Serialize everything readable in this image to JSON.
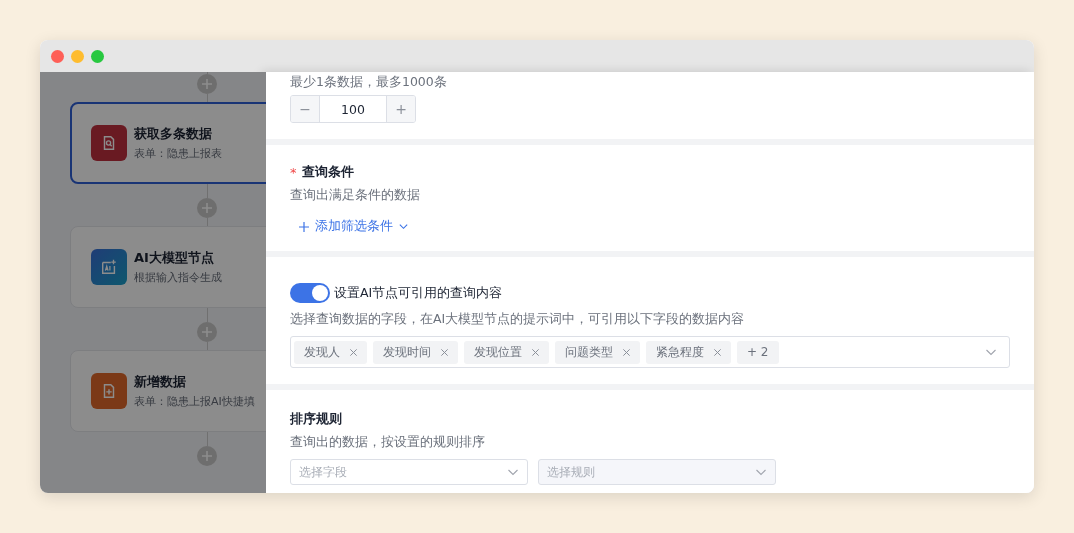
{
  "flow": {
    "nodes": [
      {
        "title": "获取多条数据",
        "subtitle": "表单：隐患上报表",
        "kind": "query",
        "selected": true
      },
      {
        "title": "AI大模型节点",
        "subtitle": "根据输入指令生成",
        "kind": "ai",
        "selected": false
      },
      {
        "title": "新增数据",
        "subtitle": "表单：隐患上报AI快捷填",
        "kind": "add",
        "selected": false
      }
    ]
  },
  "panel": {
    "limit": {
      "hint": "最少1条数据，最多1000条",
      "value": "100",
      "minus": "−",
      "plus": "+"
    },
    "conditions": {
      "required_mark": "*",
      "title": "查询条件",
      "hint": "查询出满足条件的数据",
      "add_link": "添加筛选条件"
    },
    "ai_fields": {
      "toggle_label": "设置AI节点可引用的查询内容",
      "on": true,
      "hint": "选择查询数据的字段，在AI大模型节点的提示词中，可引用以下字段的数据内容",
      "tags": [
        "发现人",
        "发现时间",
        "发现位置",
        "问题类型",
        "紧急程度"
      ],
      "more": "+ 2"
    },
    "sort": {
      "title": "排序规则",
      "hint": "查询出的数据，按设置的规则排序",
      "field_placeholder": "选择字段",
      "rule_placeholder": "选择规则"
    }
  }
}
